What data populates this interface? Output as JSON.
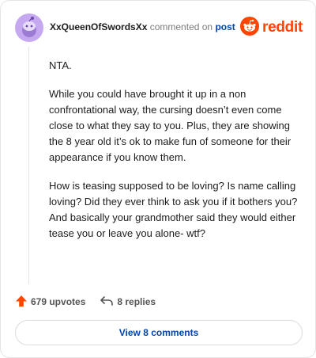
{
  "comment": {
    "username": "XxQueenOfSwordsXx",
    "action_text": "commented on",
    "post_link": "post",
    "brand": "reddit",
    "paragraphs": [
      "NTA.",
      "While you could have brought it up in a non confrontational way, the cursing doesn’t even come close to what they say to you. Plus, they are showing the 8 year old it’s ok to make fun of someone for their appearance if you know them.",
      "How is teasing supposed to be loving? Is name calling loving? Did they ever think to ask you if it bothers you? And basically your grandmother said they would either tease you or leave you alone- wtf?"
    ]
  },
  "actions": {
    "upvotes": "679 upvotes",
    "replies": "8 replies"
  },
  "footer": {
    "view_comments": "View 8 comments"
  },
  "colors": {
    "brand": "#ff4500",
    "link": "#0045ac",
    "avatar_bg": "#c6a8f0"
  },
  "icons": {
    "avatar": "snoo-avatar-icon",
    "logo": "reddit-logo-icon",
    "upvote": "upvote-arrow-icon",
    "reply": "reply-arrow-icon"
  }
}
